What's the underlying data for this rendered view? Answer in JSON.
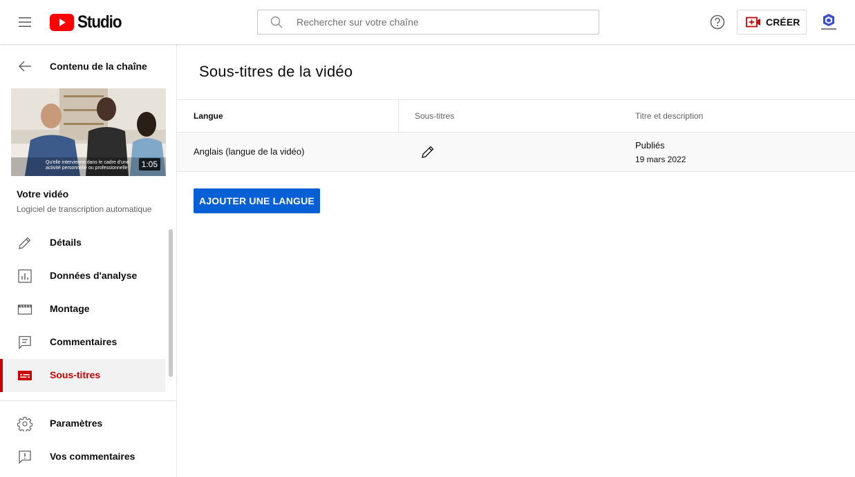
{
  "header": {
    "logo_text": "Studio",
    "search_placeholder": "Rechercher sur votre chaîne",
    "create_label": "CRÉER",
    "icons": [
      "hamburger-icon",
      "youtube-logo-icon",
      "search-icon",
      "help-icon",
      "create-video-icon",
      "channel-avatar-icon"
    ]
  },
  "sidebar": {
    "back_label": "Contenu de la chaîne",
    "thumbnail": {
      "caption": "Qu'elle intervienne dans le cadre d'une activité personnelle ou professionnelle",
      "duration": "1:05"
    },
    "video_title": "Votre vidéo",
    "video_desc": "Logiciel de transcription automatique",
    "items": [
      {
        "label": "Détails",
        "icon": "pencil-icon",
        "active": false
      },
      {
        "label": "Données d'analyse",
        "icon": "analytics-icon",
        "active": false
      },
      {
        "label": "Montage",
        "icon": "clapperboard-icon",
        "active": false
      },
      {
        "label": "Commentaires",
        "icon": "comment-icon",
        "active": false
      },
      {
        "label": "Sous-titres",
        "icon": "subtitles-icon",
        "active": true
      }
    ],
    "bottom_items": [
      {
        "label": "Paramètres",
        "icon": "gear-icon"
      },
      {
        "label": "Vos commentaires",
        "icon": "feedback-icon"
      }
    ]
  },
  "main": {
    "title": "Sous-titres de la vidéo",
    "table": {
      "headers": [
        "Langue",
        "Sous-titres",
        "Titre et description"
      ],
      "rows": [
        {
          "language": "Anglais (langue de la vidéo)",
          "status": "Publiés",
          "date": "19 mars 2022"
        }
      ]
    },
    "add_button": "AJOUTER UNE LANGUE"
  },
  "colors": {
    "accent": "#cc0000",
    "primary_button": "#065fd4",
    "youtube_red": "#ff0000"
  }
}
